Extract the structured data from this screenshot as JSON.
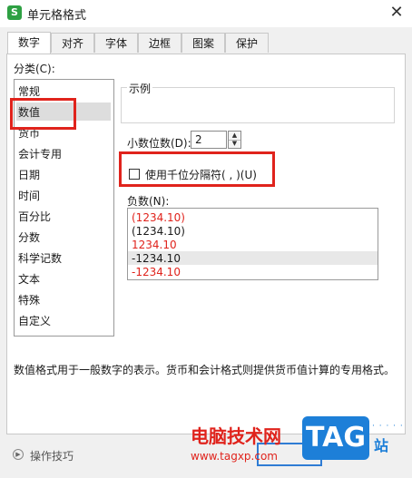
{
  "window": {
    "title": "单元格格式",
    "app_icon": "S",
    "close": "✕"
  },
  "tabs": [
    "数字",
    "对齐",
    "字体",
    "边框",
    "图案",
    "保护"
  ],
  "category": {
    "label": "分类(C):",
    "items": [
      "常规",
      "数值",
      "货币",
      "会计专用",
      "日期",
      "时间",
      "百分比",
      "分数",
      "科学记数",
      "文本",
      "特殊",
      "自定义"
    ],
    "selected": "数值"
  },
  "example": {
    "label": "示例"
  },
  "decimal": {
    "label": "小数位数(D):",
    "value": "2"
  },
  "thousands": {
    "label": "使用千位分隔符( , )(U)",
    "checked": false
  },
  "negative": {
    "label": "负数(N):",
    "items": [
      {
        "text": "(1234.10)",
        "color": "#e0231c"
      },
      {
        "text": "(1234.10)",
        "color": "#1a1a1a"
      },
      {
        "text": "1234.10",
        "color": "#e0231c"
      },
      {
        "text": "-1234.10",
        "color": "#1a1a1a"
      },
      {
        "text": "-1234.10",
        "color": "#e0231c"
      }
    ],
    "selected_index": 3
  },
  "description": "数值格式用于一般数字的表示。货币和会计格式则提供货币值计算的专用格式。",
  "footer": {
    "tips": "操作技巧"
  },
  "watermark": {
    "site_cn": "电脑技术网",
    "url": "www.tagxp.com",
    "tag": "TAG",
    "zhan": "站",
    "dots": "· · · · ·"
  },
  "colors": {
    "highlight": "#e0231c",
    "accent": "#2f7cd4",
    "tag_blue": "#1d7fd8"
  }
}
